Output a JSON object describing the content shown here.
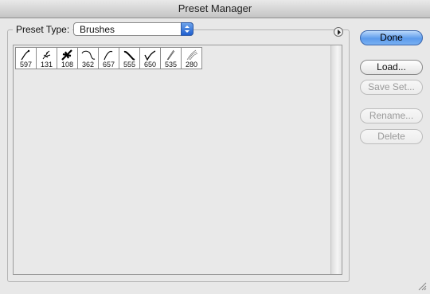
{
  "window": {
    "title": "Preset Manager"
  },
  "preset": {
    "label": "Preset Type:",
    "selected": "Brushes"
  },
  "brushes": [
    {
      "size": "597"
    },
    {
      "size": "131"
    },
    {
      "size": "108"
    },
    {
      "size": "362"
    },
    {
      "size": "657"
    },
    {
      "size": "555"
    },
    {
      "size": "650"
    },
    {
      "size": "535"
    },
    {
      "size": "280"
    }
  ],
  "buttons": {
    "done": "Done",
    "load": "Load...",
    "save_set": "Save Set...",
    "rename": "Rename...",
    "delete": "Delete"
  },
  "colors": {
    "accent": "#5d9bec",
    "disabled_text": "#9a9a9a"
  }
}
